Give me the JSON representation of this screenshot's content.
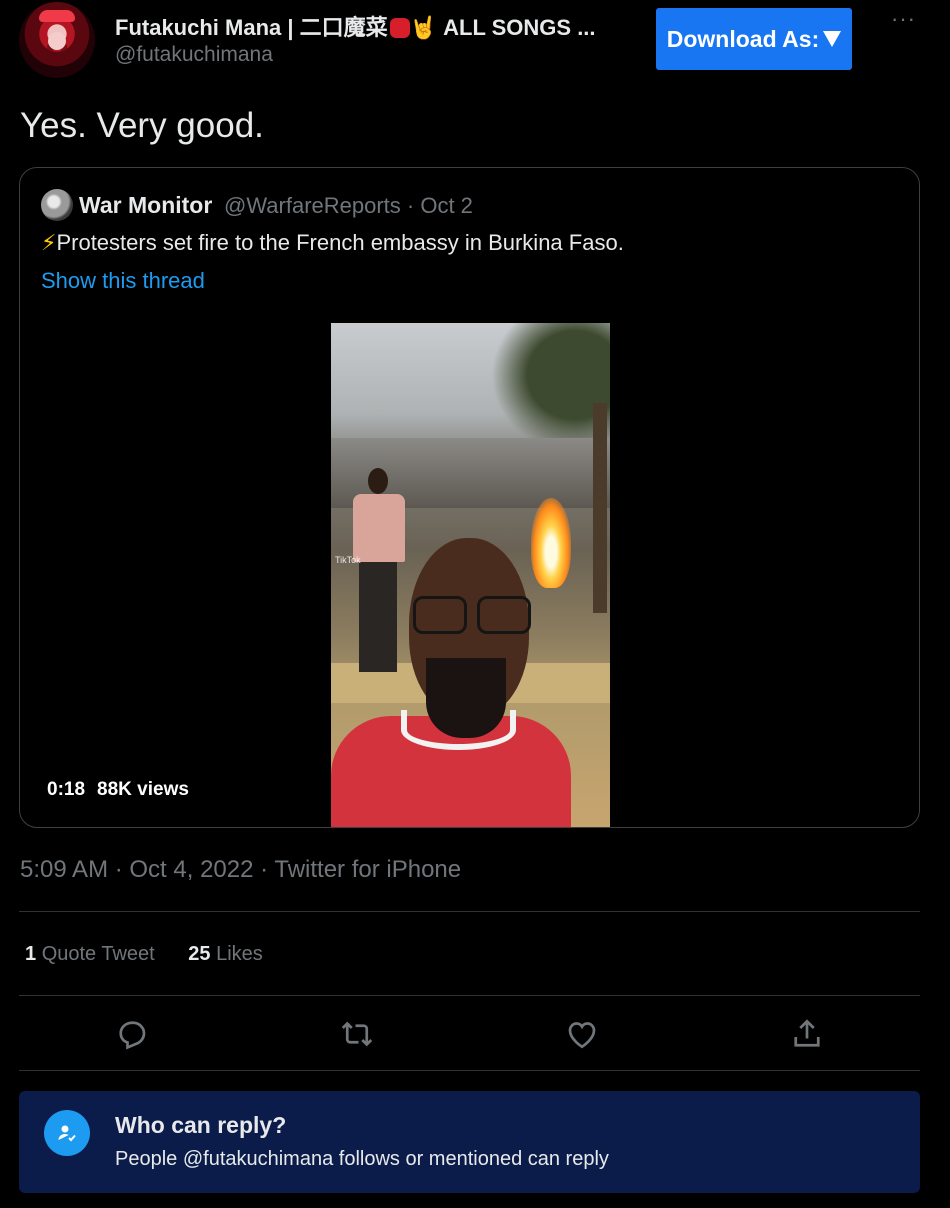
{
  "author": {
    "name": "Futakuchi Mana | 二口魔菜",
    "name_suffix": "🤘 ALL SONGS ...",
    "handle": "@futakuchimana"
  },
  "toolbar": {
    "download_label": "Download As:",
    "more_label": "···"
  },
  "tweet": {
    "text": "Yes. Very good.",
    "timestamp": "5:09 AM · Oct 4, 2022 · Twitter for iPhone"
  },
  "quoted": {
    "name": "War Monitor",
    "handle_date": "@WarfareReports · Oct 2",
    "bolt": "⚡",
    "text": "Protesters set fire to the French embassy in Burkina Faso.",
    "show_thread": "Show this thread",
    "video": {
      "duration": "0:18",
      "views": "88K views",
      "watermark": "TikTok"
    }
  },
  "stats": {
    "quote_count": "1",
    "quote_label": "Quote Tweet",
    "like_count": "25",
    "like_label": "Likes"
  },
  "actions": {
    "icons": [
      "reply-icon",
      "retweet-icon",
      "like-icon",
      "share-icon"
    ],
    "icon_color": "#71767b"
  },
  "reply_restriction": {
    "title": "Who can reply?",
    "description": "People @futakuchimana follows or mentioned can reply"
  },
  "colors": {
    "background": "#000000",
    "accent": "#1d9bf0",
    "download_button": "#1876f2",
    "reply_box": "#0b1c4a"
  }
}
